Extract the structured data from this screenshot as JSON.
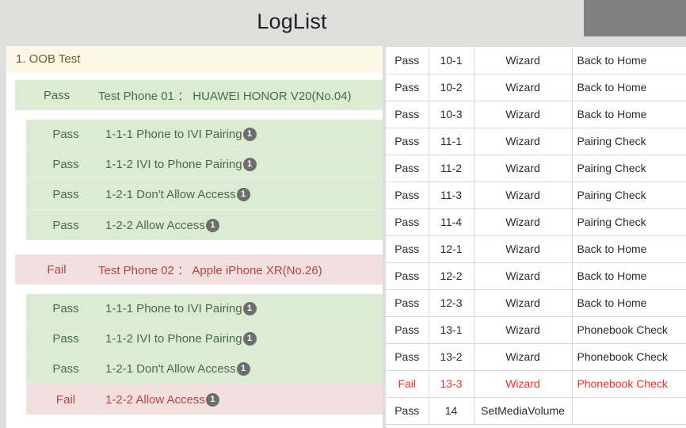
{
  "header": {
    "title": "LogList",
    "accent_panel_color": "#808080",
    "background_color": "#dededd"
  },
  "colors": {
    "pass_bg": "#dcecd4",
    "pass_text": "#4a6b49",
    "fail_bg": "#f2dfe0",
    "fail_text": "#b6443f",
    "section_bg": "#fdf7e8",
    "section_text": "#6f5a2c",
    "table_fail_text": "#ff2a21",
    "badge_bg": "#6d6d6d"
  },
  "left_panel": {
    "section": {
      "title": "1. OOB Test"
    },
    "phones": [
      {
        "status": "Pass",
        "state": "pass",
        "label": "Test Phone 01 ： HUAWEI HONOR V20(No.04)",
        "tests": [
          {
            "status": "Pass",
            "state": "pass",
            "label": "1-1-1 Phone to IVI Pairing",
            "badge": "1"
          },
          {
            "status": "Pass",
            "state": "pass",
            "label": "1-1-2 IVI to Phone Pairing",
            "badge": "1"
          },
          {
            "status": "Pass",
            "state": "pass",
            "label": "1-2-1 Don't Allow Access",
            "badge": "1"
          },
          {
            "status": "Pass",
            "state": "pass",
            "label": "1-2-2 Allow Access",
            "badge": "1"
          }
        ]
      },
      {
        "status": "Fail",
        "state": "fail",
        "label": "Test Phone 02 ： Apple iPhone XR(No.26)",
        "tests": [
          {
            "status": "Pass",
            "state": "pass",
            "label": "1-1-1 Phone to IVI Pairing",
            "badge": "1"
          },
          {
            "status": "Pass",
            "state": "pass",
            "label": "1-1-2 IVI to Phone Pairing",
            "badge": "1"
          },
          {
            "status": "Pass",
            "state": "pass",
            "label": "1-2-1 Don't Allow Access",
            "badge": "1"
          },
          {
            "status": "Fail",
            "state": "fail",
            "label": "1-2-2 Allow Access",
            "badge": "1"
          }
        ]
      }
    ]
  },
  "right_table": {
    "rows": [
      {
        "status": "Pass",
        "state": "pass",
        "id": "10-1",
        "module": "Wizard",
        "description": "Back to Home"
      },
      {
        "status": "Pass",
        "state": "pass",
        "id": "10-2",
        "module": "Wizard",
        "description": "Back to Home"
      },
      {
        "status": "Pass",
        "state": "pass",
        "id": "10-3",
        "module": "Wizard",
        "description": "Back to Home"
      },
      {
        "status": "Pass",
        "state": "pass",
        "id": "11-1",
        "module": "Wizard",
        "description": "Pairing Check"
      },
      {
        "status": "Pass",
        "state": "pass",
        "id": "11-2",
        "module": "Wizard",
        "description": "Pairing Check"
      },
      {
        "status": "Pass",
        "state": "pass",
        "id": "11-3",
        "module": "Wizard",
        "description": "Pairing Check"
      },
      {
        "status": "Pass",
        "state": "pass",
        "id": "11-4",
        "module": "Wizard",
        "description": "Pairing Check"
      },
      {
        "status": "Pass",
        "state": "pass",
        "id": "12-1",
        "module": "Wizard",
        "description": "Back to Home"
      },
      {
        "status": "Pass",
        "state": "pass",
        "id": "12-2",
        "module": "Wizard",
        "description": "Back to Home"
      },
      {
        "status": "Pass",
        "state": "pass",
        "id": "12-3",
        "module": "Wizard",
        "description": "Back to Home"
      },
      {
        "status": "Pass",
        "state": "pass",
        "id": "13-1",
        "module": "Wizard",
        "description": "Phonebook Check"
      },
      {
        "status": "Pass",
        "state": "pass",
        "id": "13-2",
        "module": "Wizard",
        "description": "Phonebook Check"
      },
      {
        "status": "Fail",
        "state": "fail",
        "id": "13-3",
        "module": "Wizard",
        "description": "Phonebook Check"
      },
      {
        "status": "Pass",
        "state": "pass",
        "id": "14",
        "module": "SetMediaVolume",
        "description": ""
      }
    ]
  }
}
